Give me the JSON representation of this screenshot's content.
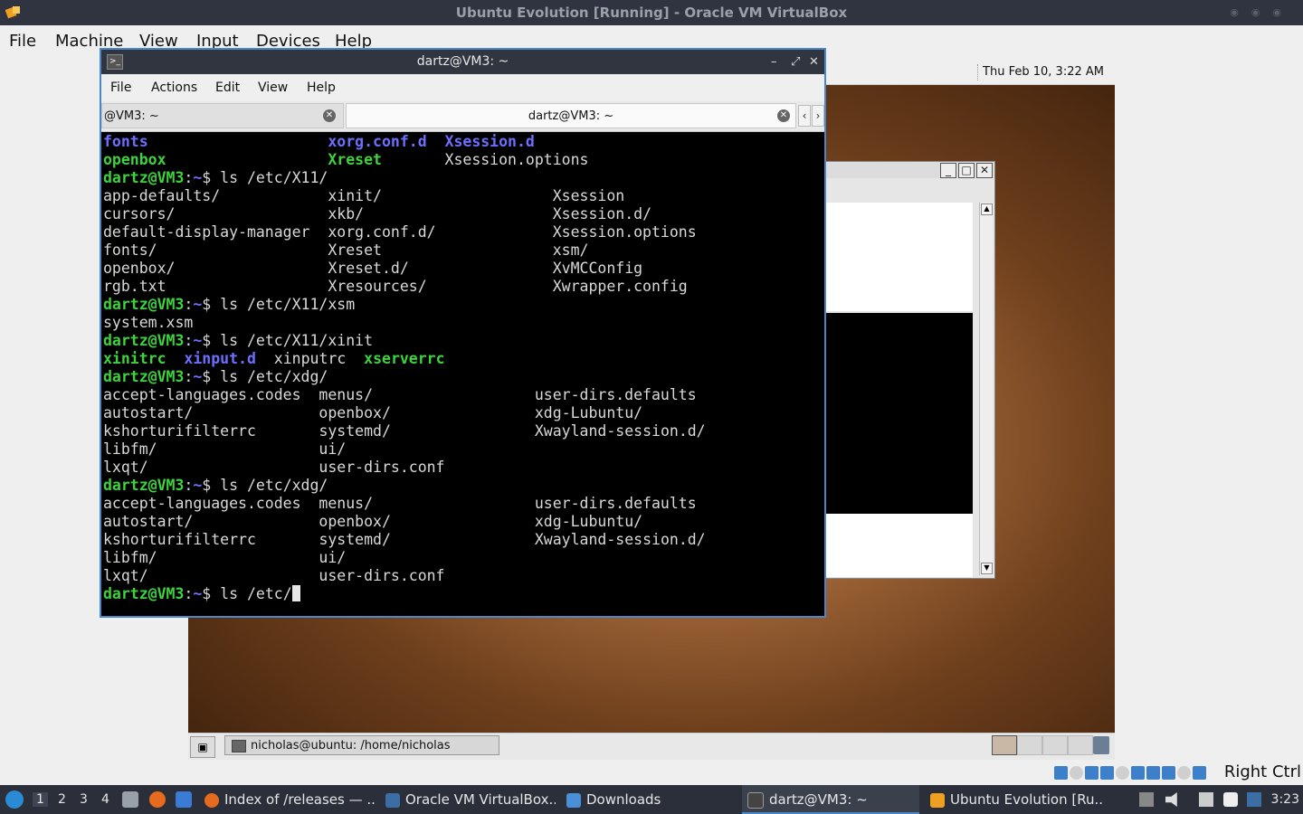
{
  "host": {
    "window_title": "Ubuntu Evolution [Running] - Oracle VM VirtualBox",
    "menu": [
      "File",
      "Machine",
      "View",
      "Input",
      "Devices",
      "Help"
    ],
    "host_key": "Right Ctrl"
  },
  "guest": {
    "clock": "Thu Feb 10,  3:22 AM",
    "taskbar_item": "nicholas@ubuntu: /home/nicholas"
  },
  "terminal": {
    "title": "dartz@VM3: ~",
    "menu": [
      "File",
      "Actions",
      "Edit",
      "View",
      "Help"
    ],
    "tabs": [
      "@VM3: ~",
      "dartz@VM3: ~"
    ],
    "prompt_user": "dartz@VM3",
    "prompt_path": "~",
    "lines": [
      {
        "kind": "cols",
        "cells": [
          {
            "t": "fonts",
            "c": "blue"
          },
          {
            "t": "xorg.conf.d",
            "c": "blue"
          },
          {
            "t": "Xsession.d",
            "c": "blue"
          }
        ],
        "widths": [
          25,
          13
        ]
      },
      {
        "kind": "cols",
        "cells": [
          {
            "t": "openbox",
            "c": "green"
          },
          {
            "t": "Xreset",
            "c": "green"
          },
          {
            "t": "Xsession.options",
            "c": ""
          }
        ],
        "widths": [
          25,
          13
        ]
      },
      {
        "kind": "prompt",
        "cmd": "ls /etc/X11/"
      },
      {
        "kind": "cols",
        "cells": [
          {
            "t": "app-defaults/"
          },
          {
            "t": "xinit/"
          },
          {
            "t": "Xsession"
          }
        ],
        "widths": [
          25,
          25
        ]
      },
      {
        "kind": "cols",
        "cells": [
          {
            "t": "cursors/"
          },
          {
            "t": "xkb/"
          },
          {
            "t": "Xsession.d/"
          }
        ],
        "widths": [
          25,
          25
        ]
      },
      {
        "kind": "cols",
        "cells": [
          {
            "t": "default-display-manager"
          },
          {
            "t": "xorg.conf.d/"
          },
          {
            "t": "Xsession.options"
          }
        ],
        "widths": [
          25,
          25
        ]
      },
      {
        "kind": "cols",
        "cells": [
          {
            "t": "fonts/"
          },
          {
            "t": "Xreset"
          },
          {
            "t": "xsm/"
          }
        ],
        "widths": [
          25,
          25
        ]
      },
      {
        "kind": "cols",
        "cells": [
          {
            "t": "openbox/"
          },
          {
            "t": "Xreset.d/"
          },
          {
            "t": "XvMCConfig"
          }
        ],
        "widths": [
          25,
          25
        ]
      },
      {
        "kind": "cols",
        "cells": [
          {
            "t": "rgb.txt"
          },
          {
            "t": "Xresources/"
          },
          {
            "t": "Xwrapper.config"
          }
        ],
        "widths": [
          25,
          25
        ]
      },
      {
        "kind": "prompt",
        "cmd": "ls /etc/X11/xsm"
      },
      {
        "kind": "cols",
        "cells": [
          {
            "t": "system.xsm"
          }
        ],
        "widths": []
      },
      {
        "kind": "prompt",
        "cmd": "ls /etc/X11/xinit"
      },
      {
        "kind": "cols",
        "cells": [
          {
            "t": "xinitrc",
            "c": "green"
          },
          {
            "t": "xinput.d",
            "c": "blue"
          },
          {
            "t": "xinputrc"
          },
          {
            "t": "xserverrc",
            "c": "green"
          }
        ],
        "widths": [
          9,
          10,
          10
        ]
      },
      {
        "kind": "prompt",
        "cmd": "ls /etc/xdg/"
      },
      {
        "kind": "cols",
        "cells": [
          {
            "t": "accept-languages.codes"
          },
          {
            "t": "menus/"
          },
          {
            "t": "user-dirs.defaults"
          }
        ],
        "widths": [
          24,
          24
        ]
      },
      {
        "kind": "cols",
        "cells": [
          {
            "t": "autostart/"
          },
          {
            "t": "openbox/"
          },
          {
            "t": "xdg-Lubuntu/"
          }
        ],
        "widths": [
          24,
          24
        ]
      },
      {
        "kind": "cols",
        "cells": [
          {
            "t": "kshorturifilterrc"
          },
          {
            "t": "systemd/"
          },
          {
            "t": "Xwayland-session.d/"
          }
        ],
        "widths": [
          24,
          24
        ]
      },
      {
        "kind": "cols",
        "cells": [
          {
            "t": "libfm/"
          },
          {
            "t": "ui/"
          }
        ],
        "widths": [
          24
        ]
      },
      {
        "kind": "cols",
        "cells": [
          {
            "t": "lxqt/"
          },
          {
            "t": "user-dirs.conf"
          }
        ],
        "widths": [
          24
        ]
      },
      {
        "kind": "prompt",
        "cmd": "ls /etc/xdg/"
      },
      {
        "kind": "cols",
        "cells": [
          {
            "t": "accept-languages.codes"
          },
          {
            "t": "menus/"
          },
          {
            "t": "user-dirs.defaults"
          }
        ],
        "widths": [
          24,
          24
        ]
      },
      {
        "kind": "cols",
        "cells": [
          {
            "t": "autostart/"
          },
          {
            "t": "openbox/"
          },
          {
            "t": "xdg-Lubuntu/"
          }
        ],
        "widths": [
          24,
          24
        ]
      },
      {
        "kind": "cols",
        "cells": [
          {
            "t": "kshorturifilterrc"
          },
          {
            "t": "systemd/"
          },
          {
            "t": "Xwayland-session.d/"
          }
        ],
        "widths": [
          24,
          24
        ]
      },
      {
        "kind": "cols",
        "cells": [
          {
            "t": "libfm/"
          },
          {
            "t": "ui/"
          }
        ],
        "widths": [
          24
        ]
      },
      {
        "kind": "cols",
        "cells": [
          {
            "t": "lxqt/"
          },
          {
            "t": "user-dirs.conf"
          }
        ],
        "widths": [
          24
        ]
      },
      {
        "kind": "prompt",
        "cmd": "ls /etc/",
        "cursor": true
      }
    ]
  },
  "taskbar": {
    "workspaces": [
      "1",
      "2",
      "3",
      "4"
    ],
    "tasks": [
      {
        "label": "Index of /releases — ...",
        "icon": "firefox-icon"
      },
      {
        "label": "Oracle VM VirtualBox...",
        "icon": "virtualbox-icon"
      },
      {
        "label": "Downloads",
        "icon": "folder-icon"
      },
      {
        "label": "dartz@VM3: ~",
        "icon": "terminal-icon",
        "active": true
      },
      {
        "label": "Ubuntu Evolution [Ru...",
        "icon": "virtualbox-vm-icon"
      }
    ],
    "clock": "3:23"
  },
  "colors": {
    "accent": "#4a86c8",
    "prompt_green": "#3cd33c",
    "dir_blue": "#6e6eff",
    "taskbar_bg": "#2b2f3a"
  }
}
